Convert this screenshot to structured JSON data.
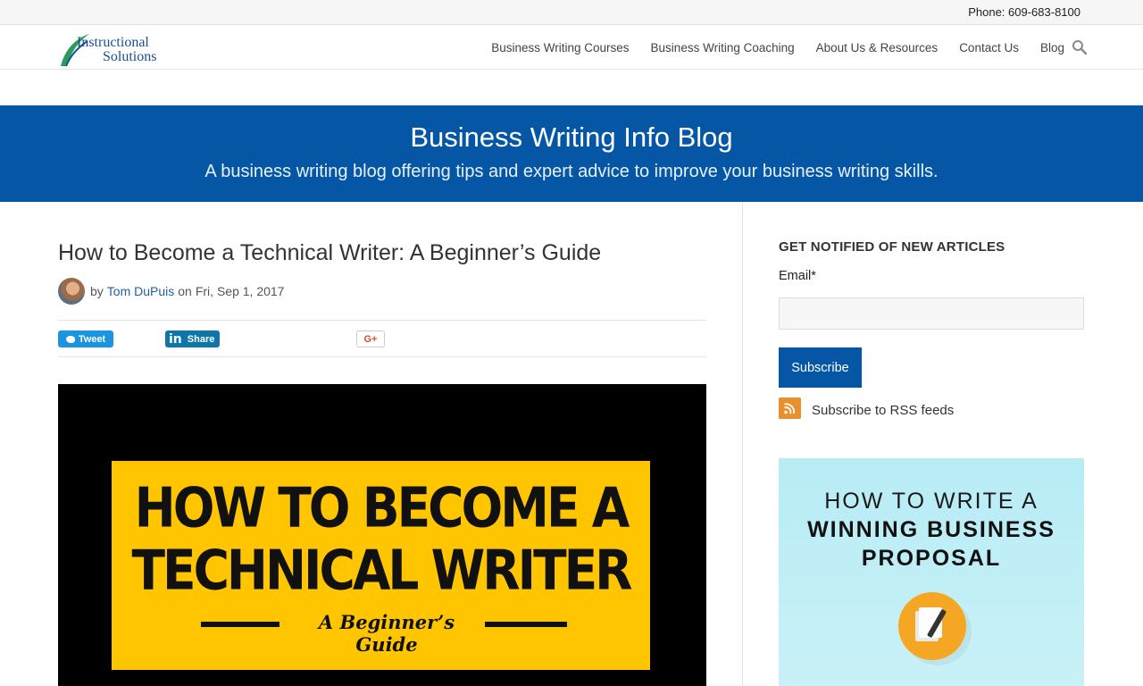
{
  "topbar": {
    "phone": "Phone: 609-683-8100"
  },
  "header": {
    "logo": {
      "line1": "Instructional",
      "line2": "Solutions"
    },
    "nav": [
      {
        "label": "Business Writing Courses"
      },
      {
        "label": "Business Writing Coaching"
      },
      {
        "label": "About Us & Resources"
      },
      {
        "label": "Contact Us"
      },
      {
        "label": "Blog"
      }
    ],
    "search_icon": "search-icon"
  },
  "banner": {
    "title": "Business Writing Info Blog",
    "subtitle": "A business writing blog offering tips and expert advice to improve your business writing skills."
  },
  "post": {
    "title": "How to Become a Technical Writer: A Beginner’s Guide",
    "by": "by",
    "author": "Tom DuPuis",
    "date_prefix": "on",
    "date": "Fri, Sep 1, 2017",
    "share": {
      "tweet": "Tweet",
      "linkedin": "Share",
      "gplus": "G+"
    },
    "hero": {
      "line1": "HOW TO BECOME A",
      "line2": "TECHNICAL WRITER",
      "line3": "A Beginner’s Guide"
    }
  },
  "sidebar": {
    "title": "GET NOTIFIED OF NEW ARTICLES",
    "email_label": "Email",
    "required_mark": "*",
    "email_value": "",
    "subscribe": "Subscribe",
    "rss": "Subscribe to RSS feeds",
    "promo": {
      "line1": "HOW TO WRITE A",
      "line2": "WINNING BUSINESS",
      "line3": "PROPOSAL"
    }
  },
  "colors": {
    "brand_blue": "#0557a6",
    "link_blue": "#1d5fa6",
    "hero_yellow": "#ffc600",
    "rss_orange": "#e8912c",
    "twitter": "#1b95e0",
    "linkedin": "#0e76a8"
  }
}
